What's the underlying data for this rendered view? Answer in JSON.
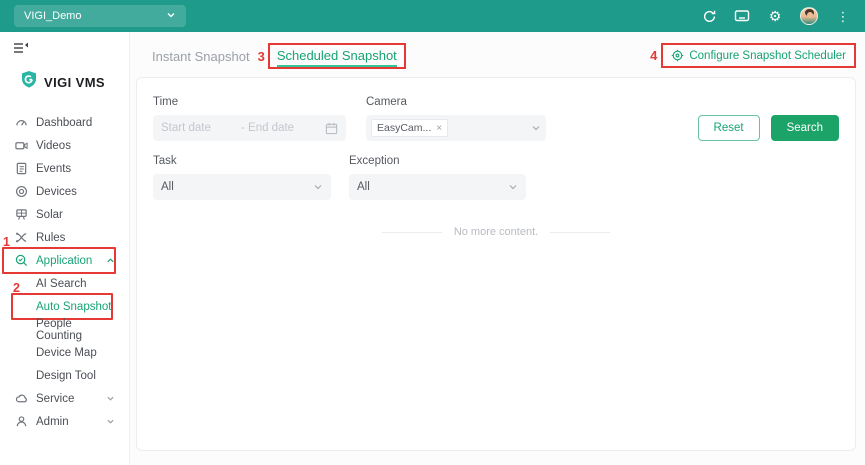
{
  "colors": {
    "topbar_bg": "#1E9B8B",
    "accent_green": "#17A376",
    "search_button_green": "#1BA368",
    "annotation_red": "#E53935",
    "brand_teal": "#2AB5A5",
    "tab_underline": "#35C498"
  },
  "topbar": {
    "site_selector_value": "VIGI_Demo"
  },
  "sidebar": {
    "logo_text": "VIGI VMS",
    "items": [
      {
        "label": "Dashboard"
      },
      {
        "label": "Videos"
      },
      {
        "label": "Events"
      },
      {
        "label": "Devices"
      },
      {
        "label": "Solar"
      },
      {
        "label": "Rules"
      },
      {
        "label": "Application",
        "state": "active-expanded"
      },
      {
        "label": "AI Search"
      },
      {
        "label": "Auto Snapshot",
        "state": "active"
      },
      {
        "label": "People Counting"
      },
      {
        "label": "Device Map"
      },
      {
        "label": "Design Tool"
      },
      {
        "label": "Service",
        "state": "collapsed"
      },
      {
        "label": "Admin",
        "state": "collapsed"
      }
    ]
  },
  "annotations": {
    "step1": "1",
    "step2": "2",
    "step3": "3",
    "step4": "4"
  },
  "main": {
    "tabs": {
      "instant": "Instant Snapshot",
      "scheduled": "Scheduled Snapshot"
    },
    "configure_link": "Configure Snapshot Scheduler",
    "filters": {
      "time_label": "Time",
      "start_date_placeholder": "Start date",
      "end_date_placeholder": "- End date",
      "camera_label": "Camera",
      "camera_selected_tag": "EasyCam...",
      "tag_remove": "×",
      "task_label": "Task",
      "task_value": "All",
      "exception_label": "Exception",
      "exception_value": "All"
    },
    "buttons": {
      "reset": "Reset",
      "search": "Search"
    },
    "empty_text": "No more content."
  },
  "icons": [
    "collapse-sidebar-icon",
    "shield-logo-icon",
    "chevron-down-icon",
    "chevron-up-icon",
    "refresh-icon",
    "screen-cast-icon",
    "settings-gear-icon",
    "user-avatar",
    "kebab-menu-icon",
    "dashboard-icon",
    "videos-icon",
    "events-icon",
    "devices-icon",
    "solar-icon",
    "rules-icon",
    "application-search-icon",
    "service-cloud-icon",
    "admin-person-icon",
    "calendar-icon",
    "configure-scheduler-gear-icon",
    "remove-tag-icon"
  ]
}
